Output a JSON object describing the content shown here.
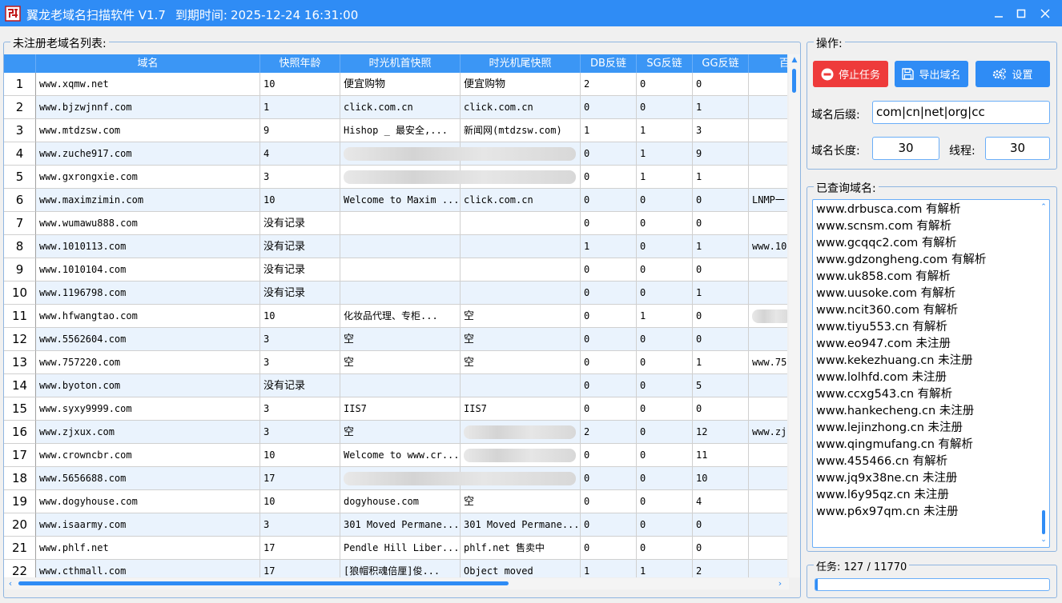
{
  "title": {
    "app_name": "翼龙老域名扫描软件 V1.7",
    "expiry_label": "到期时间:",
    "expiry_value": "2025-12-24 16:31:00"
  },
  "left_panel": {
    "legend": "未注册老域名列表:",
    "columns": [
      "域名",
      "快照年龄",
      "时光机首快照",
      "时光机尾快照",
      "DB反链",
      "SG反链",
      "GG反链",
      "百"
    ],
    "rows": [
      {
        "n": "1",
        "domain": "www.xqmw.net",
        "age": "10",
        "first": "便宜购物",
        "last": "便宜购物",
        "db": "2",
        "sg": "0",
        "gg": "0",
        "extra": ""
      },
      {
        "n": "2",
        "domain": "www.bjzwjnnf.com",
        "age": "1",
        "first": "click.com.cn",
        "last": "click.com.cn",
        "db": "0",
        "sg": "0",
        "gg": "1",
        "extra": ""
      },
      {
        "n": "3",
        "domain": "www.mtdzsw.com",
        "age": "9",
        "first": "Hishop _ 最安全,...",
        "last": "新闻网(mtdzsw.com)",
        "db": "1",
        "sg": "1",
        "gg": "3",
        "extra": ""
      },
      {
        "n": "4",
        "domain": "www.zuche917.com",
        "age": "4",
        "first": "",
        "last": "",
        "db": "0",
        "sg": "1",
        "gg": "9",
        "extra": ""
      },
      {
        "n": "5",
        "domain": "www.gxrongxie.com",
        "age": "3",
        "first": "",
        "last": "",
        "db": "0",
        "sg": "1",
        "gg": "1",
        "extra": ""
      },
      {
        "n": "6",
        "domain": "www.maximzimin.com",
        "age": "10",
        "first": "Welcome to Maxim ...",
        "last": "click.com.cn",
        "db": "0",
        "sg": "0",
        "gg": "0",
        "extra": "LNMP一"
      },
      {
        "n": "7",
        "domain": "www.wumawu888.com",
        "age": "没有记录",
        "first": "",
        "last": "",
        "db": "0",
        "sg": "0",
        "gg": "0",
        "extra": ""
      },
      {
        "n": "8",
        "domain": "www.1010113.com",
        "age": "没有记录",
        "first": "",
        "last": "",
        "db": "1",
        "sg": "0",
        "gg": "1",
        "extra": "www.10"
      },
      {
        "n": "9",
        "domain": "www.1010104.com",
        "age": "没有记录",
        "first": "",
        "last": "",
        "db": "0",
        "sg": "0",
        "gg": "0",
        "extra": ""
      },
      {
        "n": "10",
        "domain": "www.1196798.com",
        "age": "没有记录",
        "first": "",
        "last": "",
        "db": "0",
        "sg": "0",
        "gg": "1",
        "extra": ""
      },
      {
        "n": "11",
        "domain": "www.hfwangtao.com",
        "age": "10",
        "first": "化妆品代理、专柜...",
        "last": "空",
        "db": "0",
        "sg": "1",
        "gg": "0",
        "extra": ""
      },
      {
        "n": "12",
        "domain": "www.5562604.com",
        "age": "3",
        "first": "空",
        "last": "空",
        "db": "0",
        "sg": "0",
        "gg": "0",
        "extra": ""
      },
      {
        "n": "13",
        "domain": "www.757220.com",
        "age": "3",
        "first": "空",
        "last": "空",
        "db": "0",
        "sg": "0",
        "gg": "1",
        "extra": "www.75"
      },
      {
        "n": "14",
        "domain": "www.byoton.com",
        "age": "没有记录",
        "first": "",
        "last": "",
        "db": "0",
        "sg": "0",
        "gg": "5",
        "extra": ""
      },
      {
        "n": "15",
        "domain": "www.syxy9999.com",
        "age": "3",
        "first": "IIS7",
        "last": "IIS7",
        "db": "0",
        "sg": "0",
        "gg": "0",
        "extra": ""
      },
      {
        "n": "16",
        "domain": "www.zjxux.com",
        "age": "3",
        "first": "空",
        "last": "",
        "db": "2",
        "sg": "0",
        "gg": "12",
        "extra": "www.zj"
      },
      {
        "n": "17",
        "domain": "www.crowncbr.com",
        "age": "10",
        "first": "Welcome to www.cr...",
        "last": "",
        "db": "0",
        "sg": "0",
        "gg": "11",
        "extra": ""
      },
      {
        "n": "18",
        "domain": "www.5656688.com",
        "age": "17",
        "first": "",
        "last": "",
        "db": "0",
        "sg": "0",
        "gg": "10",
        "extra": ""
      },
      {
        "n": "19",
        "domain": "www.dogyhouse.com",
        "age": "10",
        "first": "dogyhouse.com",
        "last": "空",
        "db": "0",
        "sg": "0",
        "gg": "4",
        "extra": ""
      },
      {
        "n": "20",
        "domain": "www.isaarmy.com",
        "age": "3",
        "first": "301 Moved Permane...",
        "last": "301 Moved Permane...",
        "db": "0",
        "sg": "0",
        "gg": "0",
        "extra": ""
      },
      {
        "n": "21",
        "domain": "www.phlf.net",
        "age": "17",
        "first": "Pendle Hill Liber...",
        "last": "phlf.net 售卖中",
        "db": "0",
        "sg": "0",
        "gg": "0",
        "extra": ""
      },
      {
        "n": "22",
        "domain": "www.cthmall.com",
        "age": "17",
        "first": "[狼帽积魂倍厘]俊...",
        "last": "Object moved",
        "db": "1",
        "sg": "1",
        "gg": "2",
        "extra": ""
      }
    ]
  },
  "ops": {
    "legend": "操作:",
    "stop_label": "停止任务",
    "export_label": "导出域名",
    "settings_label": "设置",
    "suffix_label": "域名后缀:",
    "suffix_value": "com|cn|net|org|cc",
    "length_label": "域名长度:",
    "length_value": "30",
    "threads_label": "线程:",
    "threads_value": "30"
  },
  "queried": {
    "legend": "已查询域名:",
    "items": [
      "www.drbusca.com 有解析",
      "www.scnsm.com 有解析",
      "www.gcqqc2.com 有解析",
      "www.gdzongheng.com 有解析",
      "www.uk858.com 有解析",
      "www.uusoke.com 有解析",
      "www.ncit360.com 有解析",
      "www.tiyu553.cn 有解析",
      "www.eo947.com 未注册",
      "www.kekezhuang.cn 未注册",
      "www.lolhfd.com 未注册",
      "www.ccxg543.cn 有解析",
      "www.hankecheng.cn 未注册",
      "www.lejinzhong.cn 未注册",
      "www.qingmufang.cn 有解析",
      "www.455466.cn 有解析",
      "www.jq9x38ne.cn 未注册",
      "www.l6y95qz.cn 未注册",
      "www.p6x97qm.cn 未注册"
    ]
  },
  "task": {
    "text": "任务: 127 / 11770",
    "progress_fraction": 0.0108
  },
  "colors": {
    "title_bar": "#2f8cf5",
    "accent": "#2f8cf5",
    "stop": "#ee3b3b",
    "alt_row": "#eaf3fd"
  }
}
